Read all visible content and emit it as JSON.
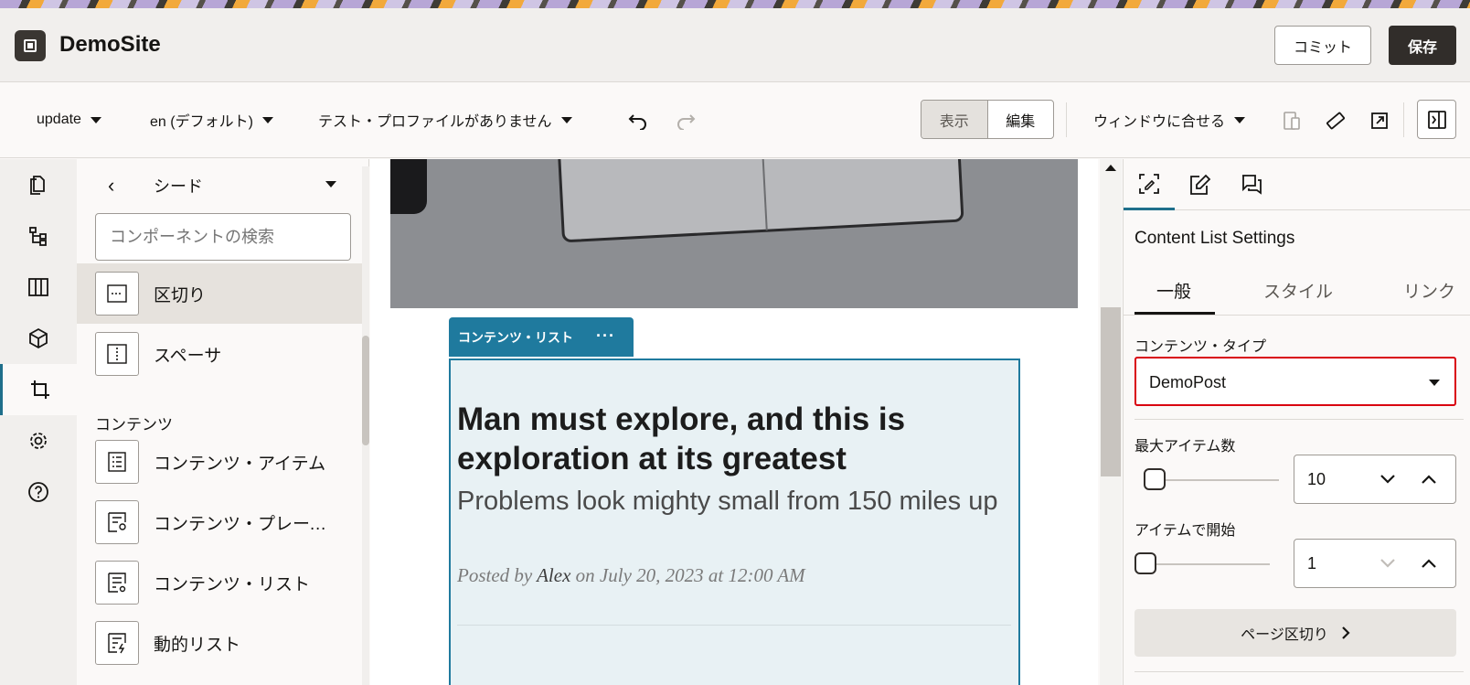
{
  "app": {
    "title": "DemoSite"
  },
  "header": {
    "commit_label": "コミット",
    "save_label": "保存"
  },
  "toolbar": {
    "update_label": "update",
    "language_label": "en (デフォルト)",
    "profile_label": "テスト・プロファイルがありません",
    "view_label": "表示",
    "edit_label": "編集",
    "fit_label": "ウィンドウに合せる"
  },
  "components": {
    "back_glyph": "‹",
    "title": "シード",
    "search_placeholder": "コンポーネントの検索",
    "items_top": [
      {
        "label": "区切り",
        "icon": "divider-icon"
      },
      {
        "label": "スペーサ",
        "icon": "spacer-icon"
      }
    ],
    "section_label": "コンテンツ",
    "items_content": [
      {
        "label": "コンテンツ・アイテム",
        "icon": "content-item-icon"
      },
      {
        "label": "コンテンツ・プレースホルダー",
        "icon": "content-placeholder-icon"
      },
      {
        "label": "コンテンツ・リスト",
        "icon": "content-list-icon"
      },
      {
        "label": "動的リスト",
        "icon": "dynamic-list-icon"
      }
    ]
  },
  "canvas": {
    "tag_label": "コンテンツ・リスト",
    "tag_menu": "···",
    "post_title": "Man must explore, and this is exploration at its greatest",
    "post_subtitle": "Problems look mighty small from 150 miles up",
    "meta_prefix": "Posted by ",
    "meta_author": "Alex",
    "meta_suffix": " on July 20, 2023 at 12:00 AM"
  },
  "settings": {
    "panel_title": "Content List Settings",
    "tabs": [
      "一般",
      "スタイル",
      "リンク"
    ],
    "content_type_label": "コンテンツ・タイプ",
    "content_type_value": "DemoPost",
    "max_items_label": "最大アイテム数",
    "max_items_value": "10",
    "start_item_label": "アイテムで開始",
    "start_item_value": "1",
    "pagination_label": "ページ区切り"
  },
  "colors": {
    "accent": "#1f7a9e",
    "highlight": "#d9000f",
    "primary_button": "#312d2a"
  }
}
